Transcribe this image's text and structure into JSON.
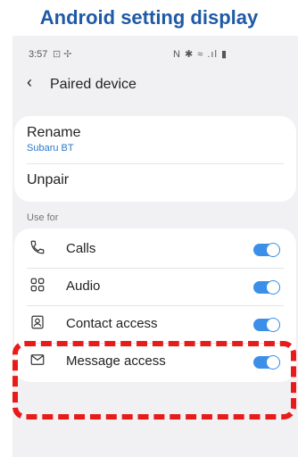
{
  "banner": {
    "title": "Android setting display"
  },
  "status_bar": {
    "time": "3:57",
    "left_icons": "⊡ ✢",
    "right_icons": "N ✱ ≈ .ıl ▮"
  },
  "header": {
    "back_icon": "back-arrow-icon",
    "title": "Paired device"
  },
  "device_card": {
    "rename_label": "Rename",
    "device_name": "Subaru BT",
    "unpair_label": "Unpair"
  },
  "use_for": {
    "section_label": "Use for",
    "items": [
      {
        "label": "Calls",
        "icon": "phone-icon",
        "enabled": true
      },
      {
        "label": "Audio",
        "icon": "audio-icon",
        "enabled": true
      },
      {
        "label": "Contact access",
        "icon": "contact-icon",
        "enabled": true
      },
      {
        "label": "Message access",
        "icon": "message-icon",
        "enabled": true
      }
    ]
  },
  "colors": {
    "accent": "#3c8fe8",
    "highlight": "#e81b1b",
    "banner_text": "#1f5aa6",
    "sublabel": "#2b78c6"
  }
}
